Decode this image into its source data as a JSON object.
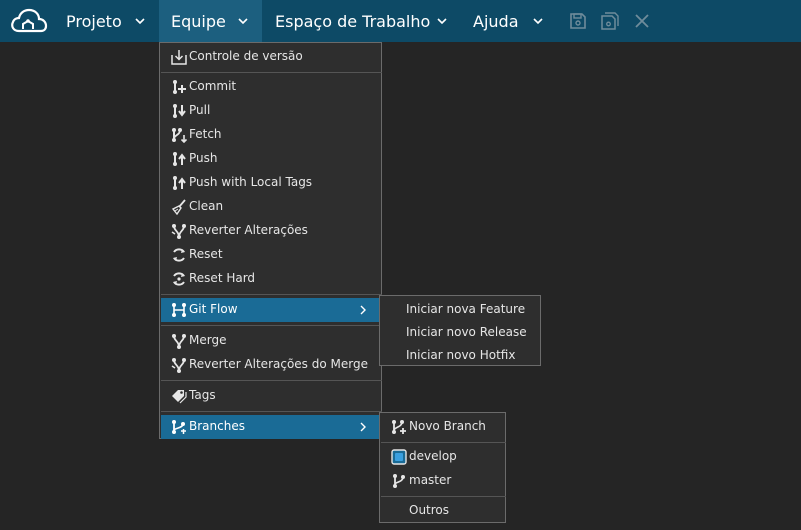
{
  "menubar": {
    "items": [
      {
        "label": "Projeto"
      },
      {
        "label": "Equipe"
      },
      {
        "label": "Espaço de Trabalho"
      },
      {
        "label": "Ajuda"
      }
    ],
    "active_index": 1
  },
  "equipe_menu": {
    "items": [
      {
        "label": "Controle de versão",
        "icon": "download-box-icon"
      },
      {
        "label": "Commit",
        "icon": "git-commit-icon"
      },
      {
        "label": "Pull",
        "icon": "git-pull-icon"
      },
      {
        "label": "Fetch",
        "icon": "git-fetch-icon"
      },
      {
        "label": "Push",
        "icon": "git-push-icon"
      },
      {
        "label": "Push with Local Tags",
        "icon": "git-push-tags-icon"
      },
      {
        "label": "Clean",
        "icon": "broom-icon"
      },
      {
        "label": "Reverter Alterações",
        "icon": "git-revert-icon"
      },
      {
        "label": "Reset",
        "icon": "reset-icon"
      },
      {
        "label": "Reset Hard",
        "icon": "reset-hard-icon"
      },
      {
        "label": "Git Flow",
        "icon": "git-flow-icon"
      },
      {
        "label": "Merge",
        "icon": "git-merge-icon"
      },
      {
        "label": "Reverter Alterações do Merge",
        "icon": "git-merge-revert-icon"
      },
      {
        "label": "Tags",
        "icon": "tags-icon"
      },
      {
        "label": "Branches",
        "icon": "git-branches-icon"
      }
    ]
  },
  "gitflow_submenu": {
    "items": [
      {
        "label": "Iniciar nova Feature"
      },
      {
        "label": "Iniciar novo Release"
      },
      {
        "label": "Iniciar novo Hotfix"
      }
    ]
  },
  "branches_submenu": {
    "new_branch": "Novo Branch",
    "branches": [
      {
        "label": "develop",
        "current": true
      },
      {
        "label": "master",
        "current": false
      }
    ],
    "others": "Outros"
  },
  "colors": {
    "menubar_bg": "#0d4a66",
    "menubar_active": "#1c5f7f",
    "menu_bg": "#2e2e2e",
    "highlight": "#1a6b96",
    "page_bg": "#252525"
  }
}
